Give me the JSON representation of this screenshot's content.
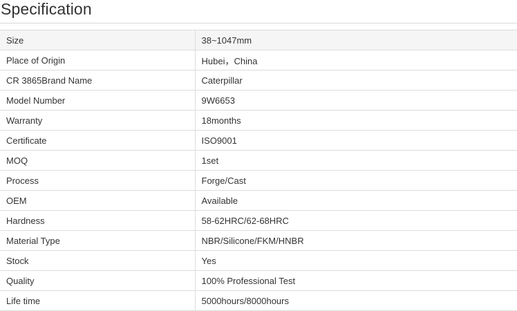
{
  "header": {
    "title": "Specification"
  },
  "spec": {
    "rows": [
      {
        "label": "Size",
        "value": "38~1047mm"
      },
      {
        "label": "Place of Origin",
        "value": "Hubei，China"
      },
      {
        "label": "CR 3865Brand Name",
        "value": "Caterpillar"
      },
      {
        "label": "Model Number",
        "value": "9W6653"
      },
      {
        "label": "Warranty",
        "value": "18months"
      },
      {
        "label": "Certificate",
        "value": "ISO9001"
      },
      {
        "label": "MOQ",
        "value": "1set"
      },
      {
        "label": "Process",
        "value": "Forge/Cast"
      },
      {
        "label": "OEM",
        "value": "Available"
      },
      {
        "label": "Hardness",
        "value": "58-62HRC/62-68HRC"
      },
      {
        "label": "Material Type",
        "value": "NBR/Silicone/FKM/HNBR"
      },
      {
        "label": "Stock",
        "value": "Yes"
      },
      {
        "label": "Quality",
        "value": "100% Professional Test"
      },
      {
        "label": "Life time",
        "value": "5000hours/8000hours"
      }
    ]
  }
}
